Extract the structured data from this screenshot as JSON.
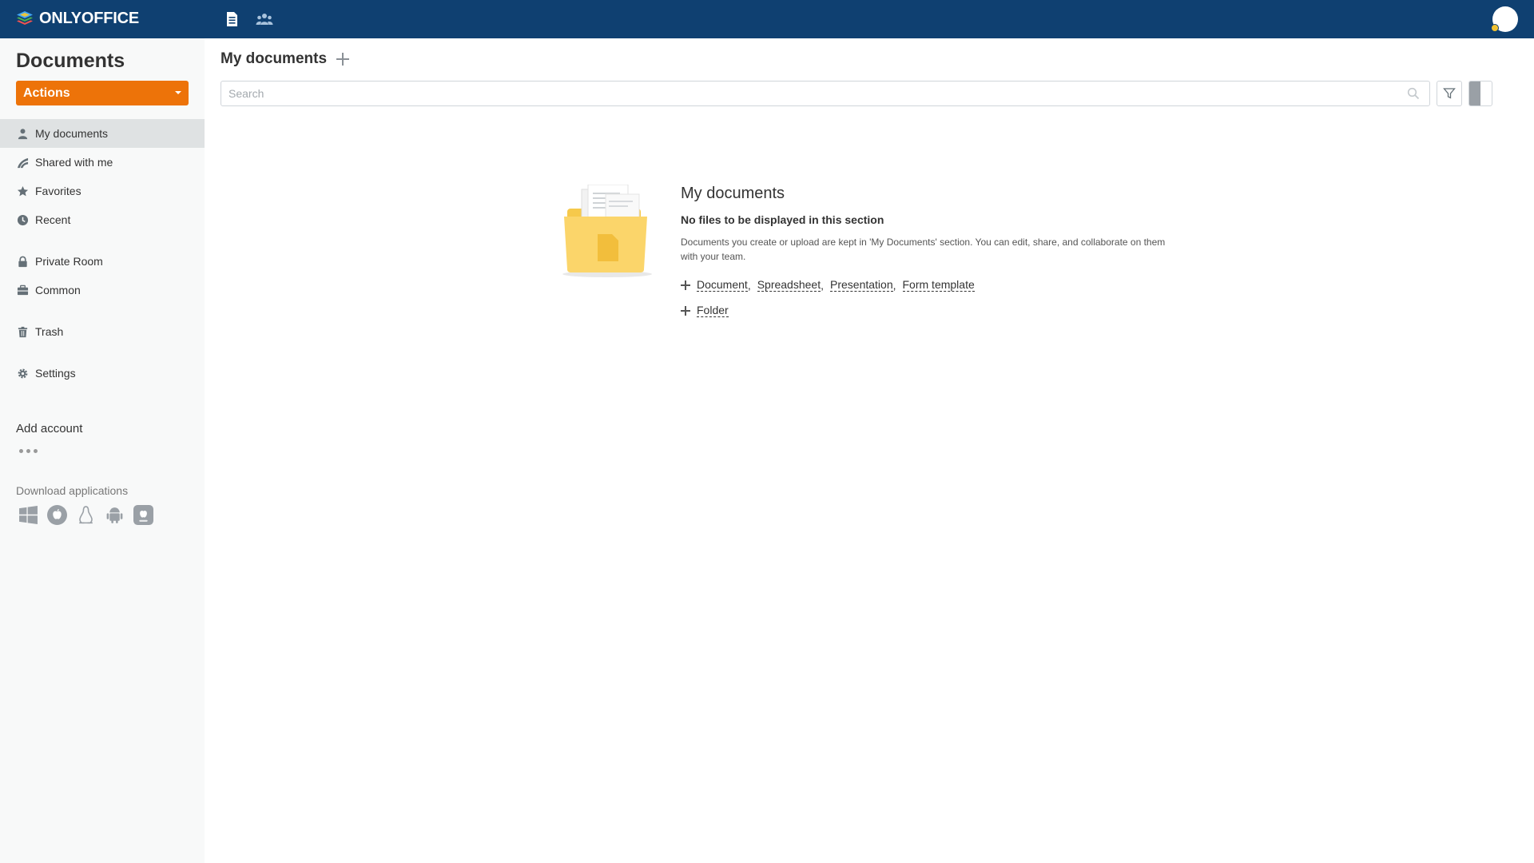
{
  "header": {
    "brand": "ONLYOFFICE",
    "icons": [
      "documents-icon",
      "people-icon"
    ],
    "colors": {
      "bar": "#0f4071",
      "logo_layers": [
        "#ef5350",
        "#4caf50",
        "#42a5f5",
        "#ffca28"
      ]
    }
  },
  "sidebar": {
    "title": "Documents",
    "actions_label": "Actions",
    "items": [
      {
        "label": "My documents",
        "icon": "person-icon",
        "active": true
      },
      {
        "label": "Shared with me",
        "icon": "share-icon",
        "active": false
      },
      {
        "label": "Favorites",
        "icon": "star-icon",
        "active": false
      },
      {
        "label": "Recent",
        "icon": "clock-icon",
        "active": false
      },
      {
        "label": "Private Room",
        "icon": "lock-icon",
        "active": false
      },
      {
        "label": "Common",
        "icon": "briefcase-icon",
        "active": false
      },
      {
        "label": "Trash",
        "icon": "trash-icon",
        "active": false
      },
      {
        "label": "Settings",
        "icon": "gear-icon",
        "active": false
      }
    ],
    "add_account": "Add account",
    "download_label": "Download applications",
    "apps": [
      "windows-icon",
      "macos-icon",
      "linux-icon",
      "android-icon",
      "ios-icon"
    ],
    "colors": {
      "actions": "#ed7309",
      "active_bg": "#dfe2e3"
    }
  },
  "main": {
    "title": "My documents",
    "search_placeholder": "Search",
    "empty": {
      "title": "My documents",
      "subtitle": "No files to be displayed in this section",
      "description": "Documents you create or upload are kept in 'My Documents' section. You can edit, share, and collaborate on them with your team.",
      "create_links": [
        "Document",
        "Spreadsheet",
        "Presentation",
        "Form template"
      ],
      "folder_link": "Folder"
    }
  }
}
